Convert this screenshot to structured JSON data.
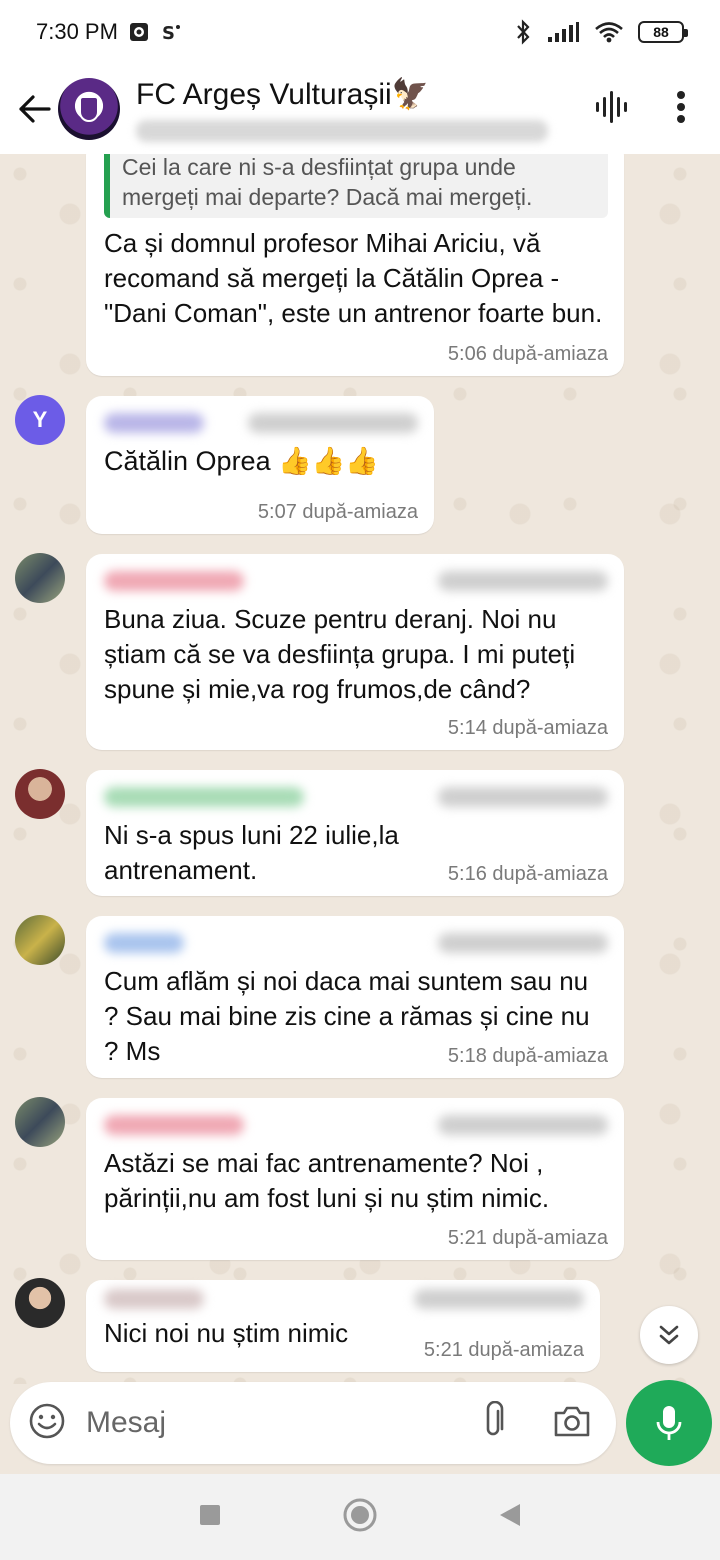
{
  "status_bar": {
    "time": "7:30 PM",
    "battery": "88"
  },
  "header": {
    "title": "FC Argeș Vulturașii🦅"
  },
  "messages": [
    {
      "quote": "Cei la care ni s-a desființat grupa unde mergeți mai departe? Dacă mai mergeți.",
      "text": "Ca și domnul profesor Mihai Ariciu, vă recomand să mergeți la Cătălin Oprea - \"Dani Coman\", este un antrenor foarte bun.",
      "time": "5:06 după-amiaza"
    },
    {
      "avatar_letter": "Y",
      "text": "Cătălin Oprea 👍👍👍",
      "time": "5:07 după-amiaza"
    },
    {
      "text": "Buna ziua. Scuze pentru deranj. Noi nu știam că se va desființa grupa. I mi puteți spune și mie,va rog frumos,de când?",
      "time": "5:14 după-amiaza"
    },
    {
      "text": "Ni s-a spus luni 22 iulie,la antrenament.",
      "time": "5:16 după-amiaza"
    },
    {
      "text": "Cum aflăm și noi daca mai suntem sau nu ? Sau mai bine zis cine a rămas și cine nu ? Ms",
      "time": "5:18 după-amiaza"
    },
    {
      "text": "Astăzi se mai fac antrenamente? Noi , părinții,nu am fost luni și nu știm nimic.",
      "time": "5:21 după-amiaza"
    },
    {
      "text": "Nici noi nu știm nimic",
      "time": "5:21 după-amiaza"
    }
  ],
  "input": {
    "placeholder": "Mesaj"
  },
  "colors": {
    "accent": "#1faa59",
    "quote_bar": "#25a050",
    "chat_bg": "#efe7dd"
  }
}
